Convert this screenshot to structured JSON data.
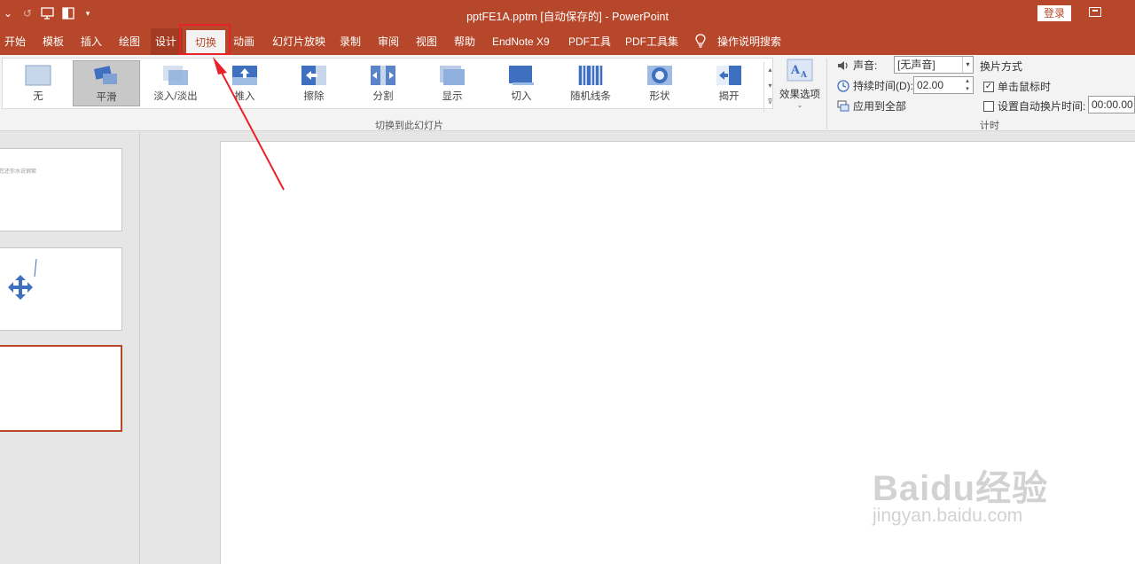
{
  "title_bar": {
    "doc_title": "pptFE1A.pptm [自动保存的] - PowerPoint",
    "login_label": "登录",
    "qat_icons": [
      "customize-chevron-icon",
      "redo-icon",
      "from-beginning-icon",
      "layout-icon",
      "more-icon"
    ]
  },
  "tabs": [
    "开始",
    "模板",
    "插入",
    "绘图",
    "设计",
    "切换",
    "动画",
    "幻灯片放映",
    "录制",
    "审阅",
    "视图",
    "帮助",
    "EndNote X9",
    "PDF工具",
    "PDF工具集",
    "操作说明搜索"
  ],
  "active_tab": "切换",
  "ribbon": {
    "transitions": [
      "无",
      "平滑",
      "淡入/淡出",
      "推入",
      "擦除",
      "分割",
      "显示",
      "切入",
      "随机线条",
      "形状",
      "揭开"
    ],
    "selected_transition": "平滑",
    "effect_options_label": "效果选项",
    "group_transition_label": "切换到此幻灯片",
    "timing": {
      "sound_label": "声音:",
      "sound_value": "[无声音]",
      "duration_label": "持续时间(D):",
      "duration_value": "02.00",
      "apply_all_label": "应用到全部",
      "advance_header": "换片方式",
      "on_click_label": "单击鼠标时",
      "on_click_checked": true,
      "after_label": "设置自动换片时间:",
      "after_value": "00:00.00",
      "after_checked": false,
      "group_label": "计时"
    }
  },
  "slides": [
    {
      "text": "您还你水说钢紫"
    },
    {
      "text": ""
    },
    {
      "text": ""
    }
  ],
  "watermark": {
    "logo": "Baidu经验",
    "url": "jingyan.baidu.com"
  },
  "colors": {
    "accent": "#b7472a",
    "annotation": "#e8222a",
    "shape_blue": "#3f6fbf"
  }
}
